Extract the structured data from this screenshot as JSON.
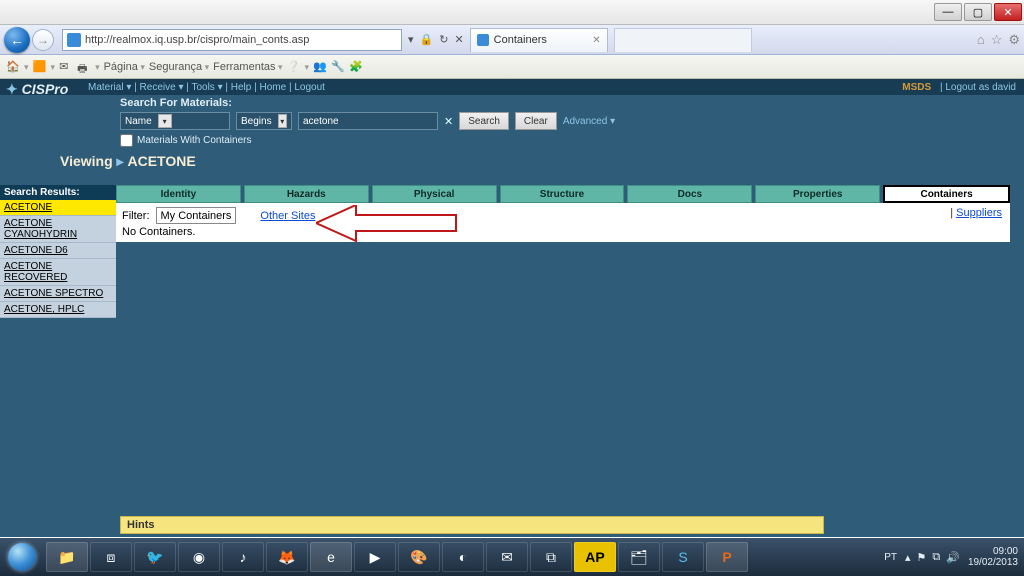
{
  "window": {
    "min": "—",
    "max": "▢",
    "close": "✕"
  },
  "browser": {
    "url": "http://realmox.iq.usp.br/cispro/main_conts.asp",
    "tab_label": "Containers",
    "cmd": {
      "page": "Página",
      "safety": "Segurança",
      "tools": "Ferramentas"
    },
    "right": {
      "home": "⌂",
      "star": "☆",
      "gear": "⚙"
    }
  },
  "app": {
    "brand": "CISPro",
    "menu": {
      "material": "Material ▾",
      "receive": "Receive ▾",
      "tools": "Tools ▾",
      "help": "Help",
      "home": "Home",
      "logout": "Logout"
    },
    "top_right": {
      "msds": "MSDS",
      "logout_as": "Logout as david"
    },
    "search": {
      "label": "Search For Materials:",
      "field": "Name",
      "op": "Begins",
      "value": "acetone",
      "search_btn": "Search",
      "clear_btn": "Clear",
      "advanced": "Advanced ▾",
      "checkbox": "Materials With Containers"
    },
    "viewing": {
      "prefix": "Viewing",
      "arrow": "▸",
      "name": "ACETONE"
    },
    "sidebar": {
      "title": "Search Results:",
      "items": [
        "ACETONE",
        "ACETONE CYANOHYDRIN",
        "ACETONE D6",
        "ACETONE RECOVERED",
        "ACETONE SPECTRO",
        "ACETONE, HPLC"
      ]
    },
    "tabs": [
      "Identity",
      "Hazards",
      "Physical",
      "Structure",
      "Docs",
      "Properties",
      "Containers"
    ],
    "panel": {
      "filter_label": "Filter:",
      "filter_value": "My Containers",
      "other_sites": "Other Sites",
      "empty": "No Containers.",
      "suppliers": "Suppliers",
      "divider": "|"
    },
    "hints": "Hints"
  },
  "taskbar": {
    "lang": "PT",
    "time": "09:00",
    "date": "19/02/2013"
  }
}
